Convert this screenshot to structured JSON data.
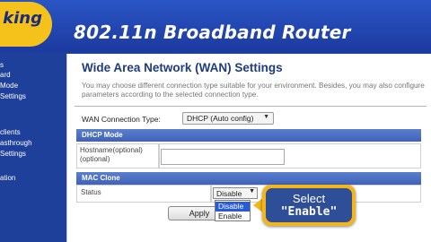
{
  "header": {
    "logo_text": "r king",
    "logo_subtext": "",
    "title": "802.11n Broadband Router"
  },
  "sidebar": {
    "items": [
      "s",
      "ard",
      "Mode",
      "Settings",
      "clients",
      "asthrough",
      "Settings",
      "ation"
    ]
  },
  "main": {
    "page_title": "Wide Area Network (WAN) Settings",
    "description": "You may choose different connection type suitable for your environment. Besides, you may also configure parameters according to the selected connection type.",
    "connection_type_label": "WAN Connection Type:",
    "connection_type_value": "DHCP (Auto config)",
    "dhcp_section": "DHCP Mode",
    "hostname_label": "Hostname(optional)\n(optional)",
    "hostname_label_l1": "Hostname(optional)",
    "hostname_label_l2": "(optional)",
    "hostname_value": "",
    "mac_section": "MAC Clone",
    "status_label": "Status",
    "status_value": "Disable",
    "status_options": [
      "Disable",
      "Enable"
    ],
    "status_highlighted_option": "Disable",
    "apply_label": "Apply"
  },
  "callout": {
    "line1": "Select",
    "line2": "\"Enable\""
  },
  "colors": {
    "background_blue": "#1e3f9a",
    "logo_yellow": "#f5c21b",
    "section_bar_blue": "#4a6dc2",
    "callout_border": "#f2b61b",
    "callout_fill": "#2e4e98",
    "selected_option": "#2a5bd7"
  }
}
